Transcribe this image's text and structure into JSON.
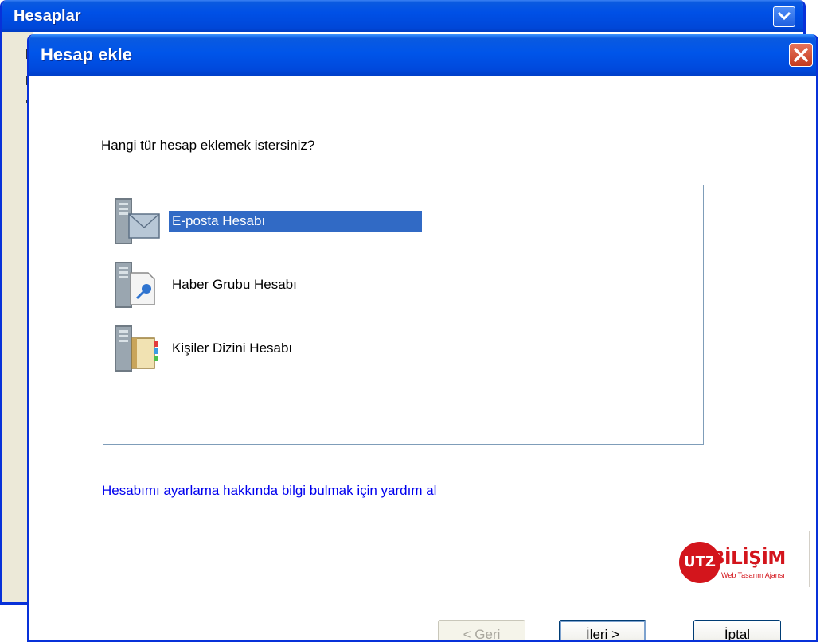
{
  "background_window": {
    "title": "Hesaplar",
    "help_icon": "chevron-down-icon"
  },
  "dialog": {
    "title": "Hesap ekle",
    "close_icon": "close-icon",
    "question": "Hangi tür hesap eklemek istersiniz?",
    "account_types": [
      {
        "label": "E-posta Hesabı",
        "icon": "mail-server-icon",
        "selected": true
      },
      {
        "label": "Haber Grubu Hesabı",
        "icon": "news-server-icon",
        "selected": false
      },
      {
        "label": "Kişiler Dizini Hesabı",
        "icon": "directory-server-icon",
        "selected": false
      }
    ],
    "help_link": "Hesabımı ayarlama hakkında bilgi bulmak için yardım al",
    "logo": {
      "badge": "UTZ",
      "word": "BİLİŞİM",
      "tagline": "Web Tasarım Ajansı",
      "color": "#d3151c"
    },
    "buttons": {
      "back": "< Geri",
      "next": "İleri >",
      "cancel": "İptal"
    }
  },
  "colors": {
    "titlebar": "#0055ea",
    "selection": "#316ac5",
    "link": "#0000ee"
  }
}
